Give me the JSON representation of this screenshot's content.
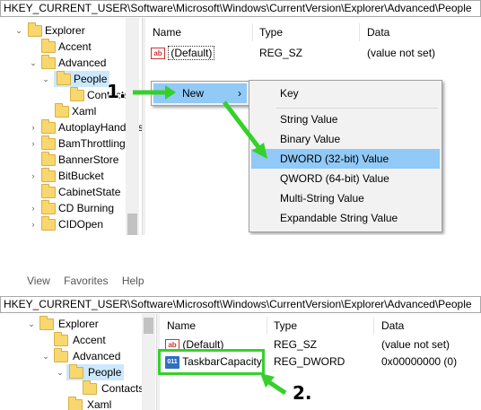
{
  "top": {
    "address": "HKEY_CURRENT_USER\\Software\\Microsoft\\Windows\\CurrentVersion\\Explorer\\Advanced\\People",
    "tree": [
      "Explorer",
      "Accent",
      "Advanced",
      "People",
      "Contacts",
      "Xaml",
      "AutoplayHandlers",
      "BamThrottling",
      "BannerStore",
      "BitBucket",
      "CabinetState",
      "CD Burning",
      "CIDOpen"
    ],
    "columns": {
      "name": "Name",
      "type": "Type",
      "data": "Data"
    },
    "rows": [
      {
        "name": "(Default)",
        "type": "REG_SZ",
        "data": "(value not set)"
      }
    ],
    "context_menu": {
      "item": "New",
      "arrow": "›"
    },
    "submenu": [
      "Key",
      "String Value",
      "Binary Value",
      "DWORD (32-bit) Value",
      "QWORD (64-bit) Value",
      "Multi-String Value",
      "Expandable String Value"
    ],
    "highlighted_submenu_item": "DWORD (32-bit) Value",
    "step_label": "1."
  },
  "bottom": {
    "menubar": [
      "View",
      "Favorites",
      "Help"
    ],
    "address": "HKEY_CURRENT_USER\\Software\\Microsoft\\Windows\\CurrentVersion\\Explorer\\Advanced\\People",
    "tree": [
      "Explorer",
      "Accent",
      "Advanced",
      "People",
      "Contacts",
      "Xaml"
    ],
    "columns": {
      "name": "Name",
      "type": "Type",
      "data": "Data"
    },
    "rows": [
      {
        "name": "(Default)",
        "type": "REG_SZ",
        "data": "(value not set)"
      },
      {
        "name": "TaskbarCapacity",
        "type": "REG_DWORD",
        "data": "0x00000000 (0)"
      }
    ],
    "step_label": "2."
  },
  "icons": {
    "string_value": "ab",
    "dword_value": "011"
  },
  "colors": {
    "highlight_green": "#35d12a",
    "menu_highlight": "#91c9f7",
    "tree_selection": "#cce8ff",
    "folder": "#f8d76e"
  }
}
